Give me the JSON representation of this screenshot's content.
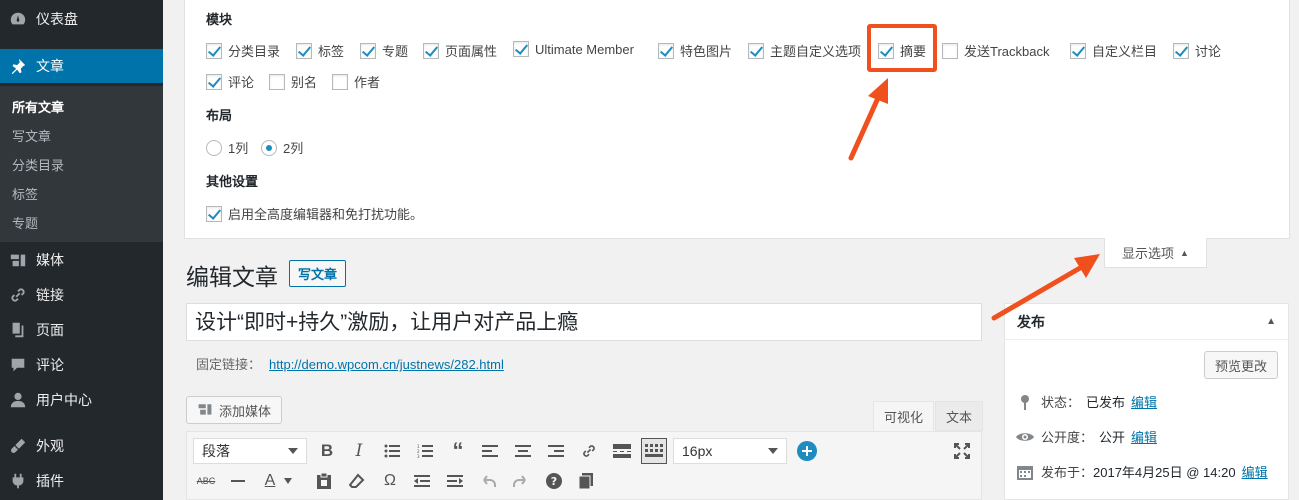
{
  "sidebar": {
    "items": [
      {
        "label": "仪表盘",
        "icon": "dashboard-icon"
      },
      {
        "label": "文章",
        "icon": "pin-icon"
      },
      {
        "label": "媒体",
        "icon": "media-icon"
      },
      {
        "label": "链接",
        "icon": "link-icon"
      },
      {
        "label": "页面",
        "icon": "page-icon"
      },
      {
        "label": "评论",
        "icon": "comment-icon"
      },
      {
        "label": "用户中心",
        "icon": "user-icon"
      },
      {
        "label": "外观",
        "icon": "appearance-icon"
      },
      {
        "label": "插件",
        "icon": "plugin-icon"
      }
    ],
    "submenu": [
      "所有文章",
      "写文章",
      "分类目录",
      "标签",
      "专题"
    ]
  },
  "screen_options": {
    "modules_title": "模块",
    "modules": [
      {
        "label": "分类目录",
        "checked": true
      },
      {
        "label": "标签",
        "checked": true
      },
      {
        "label": "专题",
        "checked": true
      },
      {
        "label": "页面属性",
        "checked": true
      },
      {
        "label": "Ultimate Member",
        "checked": true
      },
      {
        "label": "特色图片",
        "checked": true
      },
      {
        "label": "主题自定义选项",
        "checked": true
      },
      {
        "label": "摘要",
        "checked": true
      },
      {
        "label": "发送Trackback",
        "checked": false
      },
      {
        "label": "自定义栏目",
        "checked": true
      },
      {
        "label": "讨论",
        "checked": true
      },
      {
        "label": "评论",
        "checked": true
      },
      {
        "label": "别名",
        "checked": false
      },
      {
        "label": "作者",
        "checked": false
      }
    ],
    "layout_title": "布局",
    "layout_options": [
      {
        "label": "1列",
        "checked": false
      },
      {
        "label": "2列",
        "checked": true
      }
    ],
    "other_title": "其他设置",
    "other_option": {
      "label": "启用全高度编辑器和免打扰功能。",
      "checked": true
    },
    "tab_label": "显示选项"
  },
  "editor": {
    "page_title": "编辑文章",
    "add_new_label": "写文章",
    "post_title": "设计“即时+持久”激励，让用户对产品上瘾",
    "permalink_label": "固定链接：",
    "permalink_url": "http://demo.wpcom.cn/justnews/282.html",
    "add_media_label": "添加媒体",
    "tab_visual": "可视化",
    "tab_text": "文本",
    "format_select": "段落",
    "font_size_select": "16px"
  },
  "publish": {
    "title": "发布",
    "preview_label": "预览更改",
    "status_label": "状态：",
    "status_value": "已发布",
    "visibility_label": "公开度：",
    "visibility_value": "公开",
    "published_label": "发布于：",
    "published_value": "2017年4月25日 @ 14:20",
    "edit_label": "编辑"
  },
  "colors": {
    "highlight": "#f0501e",
    "accent": "#0073aa",
    "sidebar_bg": "#23282d"
  }
}
